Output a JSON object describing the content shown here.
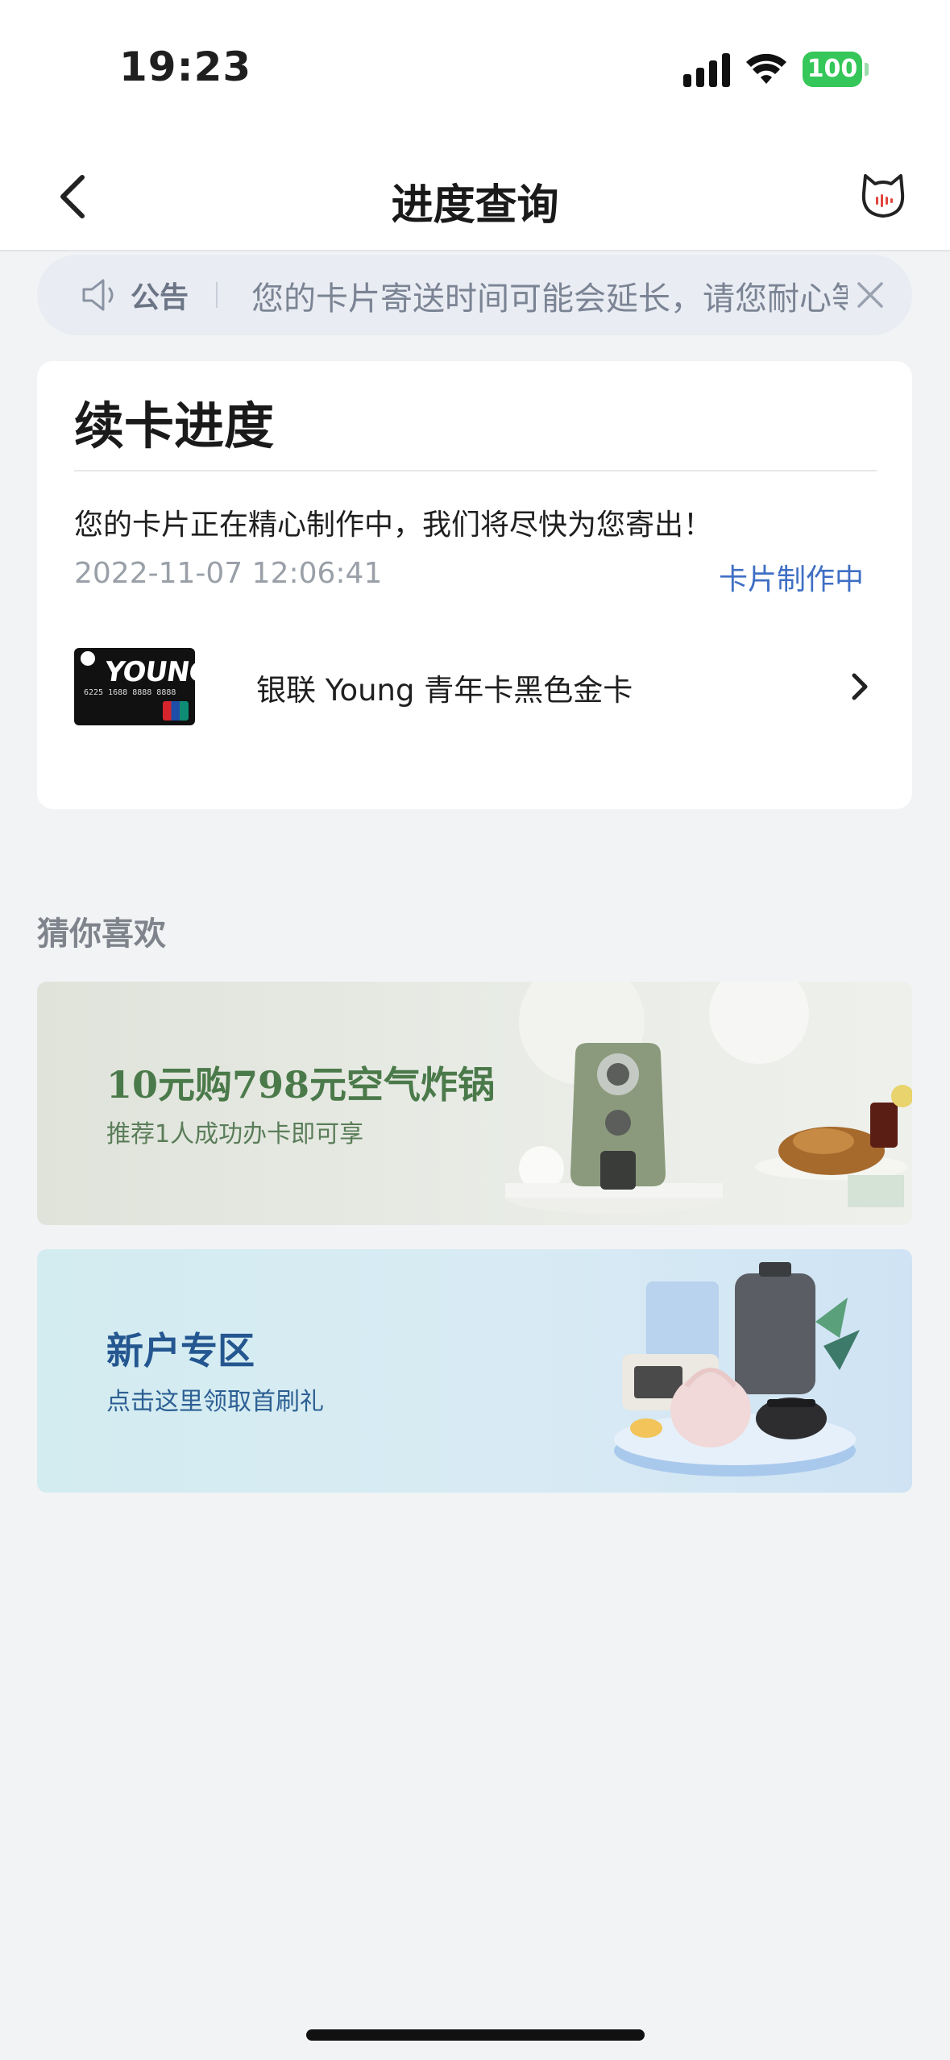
{
  "status_bar": {
    "time": "19:23",
    "battery": "100"
  },
  "nav": {
    "title": "进度查询"
  },
  "notice": {
    "label": "公告",
    "text": "您的卡片寄送时间可能会延长，请您耐心等待"
  },
  "progress_card": {
    "title": "续卡进度",
    "message": "您的卡片正在精心制作中，我们将尽快为您寄出！",
    "timestamp": "2022-11-07 12:06:41",
    "status": "卡片制作中",
    "card_name": "银联 Young 青年卡黑色金卡",
    "thumb_text": "YOUNG",
    "thumb_number": "6225 1688 8888 8888"
  },
  "recommend": {
    "title": "猜你喜欢",
    "banners": [
      {
        "title": "10元购798元空气炸锅",
        "subtitle": "推荐1人成功办卡即可享"
      },
      {
        "title": "新户专区",
        "subtitle": "点击这里领取首刷礼"
      }
    ]
  },
  "colors": {
    "accent": "#3f6fc4",
    "battery": "#35c759",
    "banner1_text": "#4b7a4a",
    "banner2_text": "#245690"
  }
}
